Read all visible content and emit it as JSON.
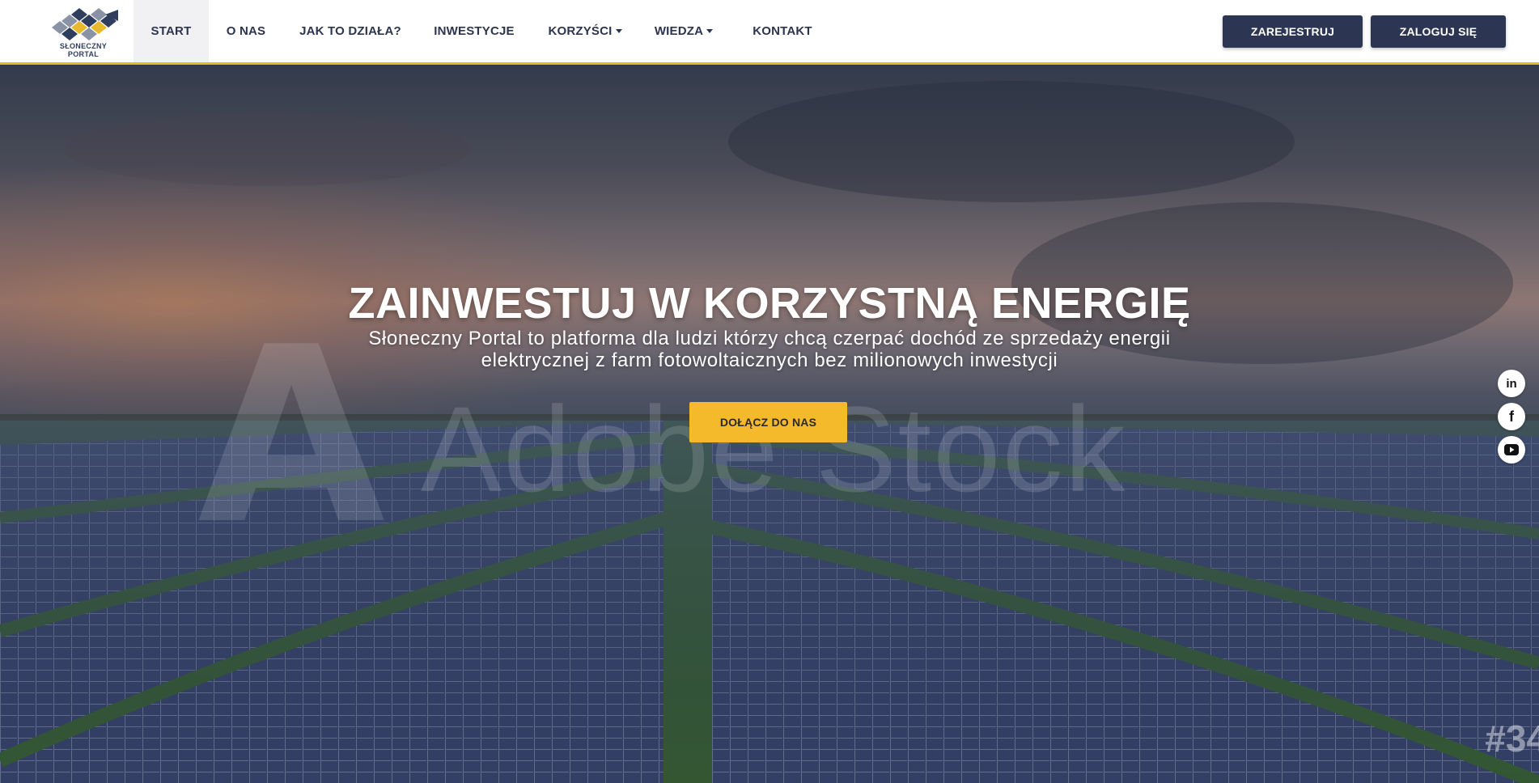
{
  "brand": {
    "name_line1": "SŁONECZNY",
    "name_line2": "PORTAL",
    "logo_colors": [
      "#2f3e5c",
      "#e7b92c",
      "#8a93a6"
    ]
  },
  "nav": {
    "items": [
      {
        "label": "START",
        "active": true
      },
      {
        "label": "O NAS"
      },
      {
        "label": "JAK TO DZIAŁA?"
      },
      {
        "label": "INWESTYCJE"
      },
      {
        "label": "KORZYŚCI",
        "dropdown": true
      },
      {
        "label": "WIEDZA",
        "dropdown": true
      },
      {
        "label": "KONTAKT"
      }
    ],
    "register_label": "ZAREJESTRUJ",
    "login_label": "ZALOGUJ SIĘ"
  },
  "hero": {
    "title": "ZAINWESTUJ W KORZYSTNĄ ENERGIĘ",
    "subtitle": "Słoneczny Portal to platforma dla ludzi którzy chcą czerpać dochód ze sprzedaży energii elektrycznej z farm fotowoltaicznych bez milionowych inwestycji",
    "cta_label": "DOŁĄCZ DO NAS",
    "watermark_text": "Adobe Stock",
    "watermark_code": "#34"
  },
  "social": [
    {
      "icon": "linkedin-icon",
      "glyph": "in"
    },
    {
      "icon": "facebook-icon",
      "glyph": "f"
    },
    {
      "icon": "youtube-icon",
      "glyph": "▶"
    }
  ],
  "colors": {
    "accent": "#f5b92c",
    "navbar_border": "#e7b92c",
    "button_dark": "#2c3652",
    "nav_text": "#2c3550"
  }
}
